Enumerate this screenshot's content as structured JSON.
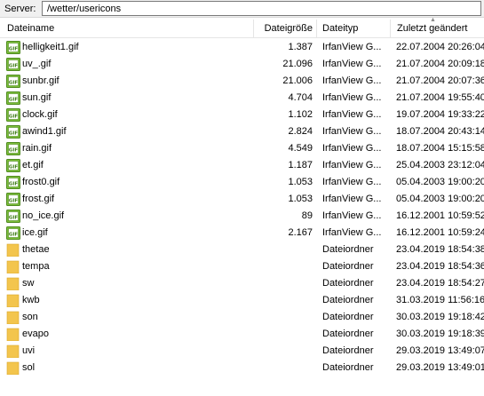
{
  "server": {
    "label": "Server:",
    "path": "/wetter/usericons"
  },
  "columns": {
    "name": "Dateiname",
    "size": "Dateigröße",
    "type": "Dateityp",
    "date": "Zuletzt geändert",
    "sorted_by": "date"
  },
  "icons": {
    "gif": "gif-file-icon",
    "folder": "folder-icon"
  },
  "colors": {
    "gif_icon": "#7cbf3a",
    "folder_icon": "#f3c54d"
  },
  "files": [
    {
      "name": "helligkeit1.gif",
      "size": "1.387",
      "type": "IrfanView G...",
      "date": "22.07.2004 20:26:04",
      "kind": "gif"
    },
    {
      "name": "uv_.gif",
      "size": "21.096",
      "type": "IrfanView G...",
      "date": "21.07.2004 20:09:18",
      "kind": "gif"
    },
    {
      "name": "sunbr.gif",
      "size": "21.006",
      "type": "IrfanView G...",
      "date": "21.07.2004 20:07:36",
      "kind": "gif"
    },
    {
      "name": "sun.gif",
      "size": "4.704",
      "type": "IrfanView G...",
      "date": "21.07.2004 19:55:40",
      "kind": "gif"
    },
    {
      "name": "clock.gif",
      "size": "1.102",
      "type": "IrfanView G...",
      "date": "19.07.2004 19:33:22",
      "kind": "gif"
    },
    {
      "name": "awind1.gif",
      "size": "2.824",
      "type": "IrfanView G...",
      "date": "18.07.2004 20:43:14",
      "kind": "gif"
    },
    {
      "name": "rain.gif",
      "size": "4.549",
      "type": "IrfanView G...",
      "date": "18.07.2004 15:15:58",
      "kind": "gif"
    },
    {
      "name": "et.gif",
      "size": "1.187",
      "type": "IrfanView G...",
      "date": "25.04.2003 23:12:04",
      "kind": "gif"
    },
    {
      "name": "frost0.gif",
      "size": "1.053",
      "type": "IrfanView G...",
      "date": "05.04.2003 19:00:20",
      "kind": "gif"
    },
    {
      "name": "frost.gif",
      "size": "1.053",
      "type": "IrfanView G...",
      "date": "05.04.2003 19:00:20",
      "kind": "gif"
    },
    {
      "name": "no_ice.gif",
      "size": "89",
      "type": "IrfanView G...",
      "date": "16.12.2001 10:59:52",
      "kind": "gif"
    },
    {
      "name": "ice.gif",
      "size": "2.167",
      "type": "IrfanView G...",
      "date": "16.12.2001 10:59:24",
      "kind": "gif"
    },
    {
      "name": "thetae",
      "size": "",
      "type": "Dateiordner",
      "date": "23.04.2019 18:54:38",
      "kind": "folder"
    },
    {
      "name": "tempa",
      "size": "",
      "type": "Dateiordner",
      "date": "23.04.2019 18:54:36",
      "kind": "folder"
    },
    {
      "name": "sw",
      "size": "",
      "type": "Dateiordner",
      "date": "23.04.2019 18:54:27",
      "kind": "folder"
    },
    {
      "name": "kwb",
      "size": "",
      "type": "Dateiordner",
      "date": "31.03.2019 11:56:16",
      "kind": "folder"
    },
    {
      "name": "son",
      "size": "",
      "type": "Dateiordner",
      "date": "30.03.2019 19:18:42",
      "kind": "folder"
    },
    {
      "name": "evapo",
      "size": "",
      "type": "Dateiordner",
      "date": "30.03.2019 19:18:39",
      "kind": "folder"
    },
    {
      "name": "uvi",
      "size": "",
      "type": "Dateiordner",
      "date": "29.03.2019 13:49:07",
      "kind": "folder"
    },
    {
      "name": "sol",
      "size": "",
      "type": "Dateiordner",
      "date": "29.03.2019 13:49:01",
      "kind": "folder"
    }
  ]
}
